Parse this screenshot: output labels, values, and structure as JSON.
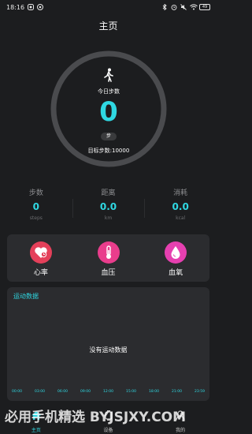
{
  "status_bar": {
    "time": "18:16",
    "battery": "49"
  },
  "header": {
    "title": "主页"
  },
  "steps_ring": {
    "today_label": "今日步数",
    "count": "0",
    "unit": "步",
    "goal_label": "目标步数:10000",
    "progress": 0
  },
  "stats": [
    {
      "label": "步数",
      "value": "0",
      "unit": "steps"
    },
    {
      "label": "距离",
      "value": "0.0",
      "unit": "km"
    },
    {
      "label": "消耗",
      "value": "0.0",
      "unit": "kcal"
    }
  ],
  "health": [
    {
      "label": "心率",
      "icon": "heart-rate-icon",
      "color": "#e4405a"
    },
    {
      "label": "血压",
      "icon": "thermometer-icon",
      "color": "#e93d8c"
    },
    {
      "label": "血氧",
      "icon": "blood-drop-icon",
      "color": "#e640b0"
    }
  ],
  "sport": {
    "title": "运动数据",
    "empty_text": "没有运动数据",
    "time_ticks": [
      "00:00",
      "03:00",
      "06:00",
      "09:00",
      "12:00",
      "15:00",
      "18:00",
      "21:00",
      "23:59"
    ]
  },
  "tabs": [
    {
      "label": "主页",
      "icon": "home-icon",
      "active": true
    },
    {
      "label": "设备",
      "icon": "device-icon",
      "active": false
    },
    {
      "label": "我的",
      "icon": "profile-icon",
      "active": false
    }
  ],
  "watermark": "必用手机精选 BYJSJXY.COM",
  "colors": {
    "accent": "#2fd8e2",
    "background": "#1c1d1f",
    "card": "#2b2c2f",
    "ring": "#4a4b4e"
  }
}
